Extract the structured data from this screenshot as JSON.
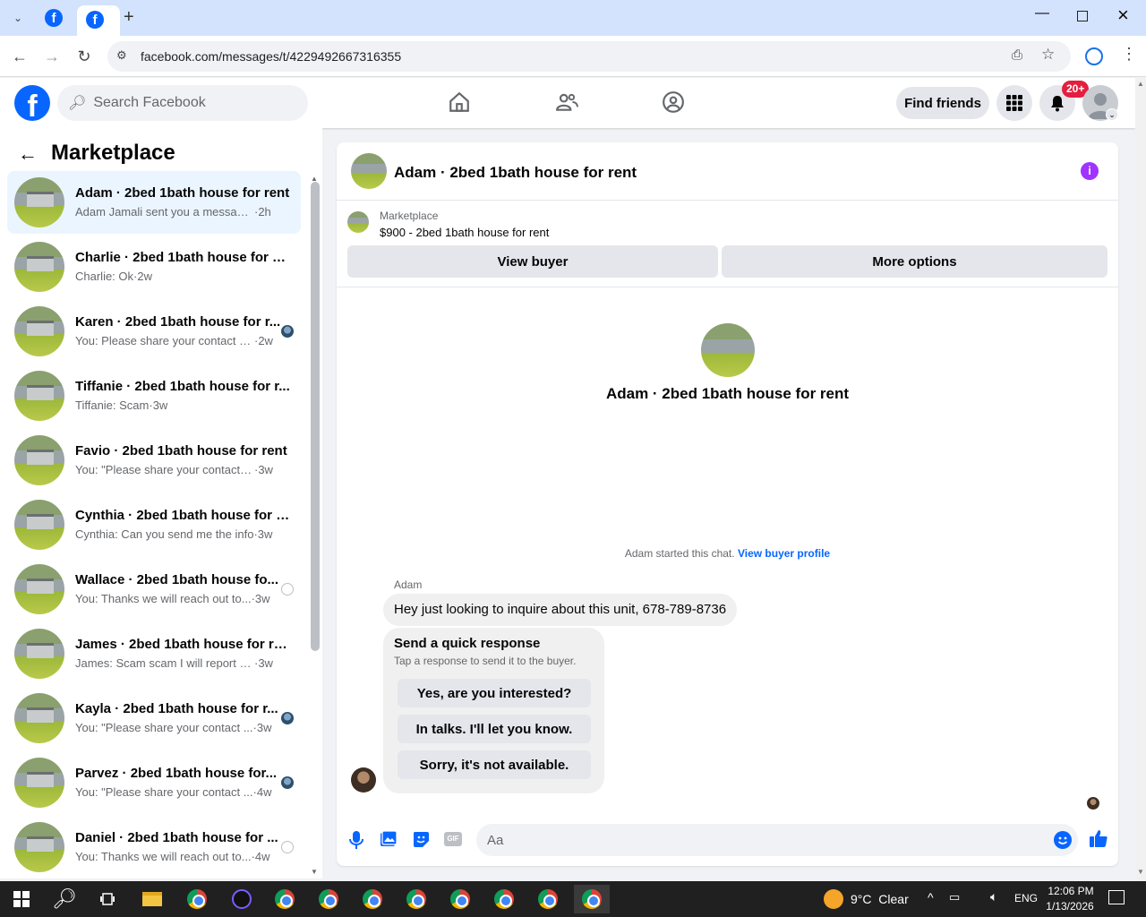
{
  "browser": {
    "url": "facebook.com/messages/t/4229492667316355",
    "new_tab": "+"
  },
  "header": {
    "search_placeholder": "Search Facebook",
    "find_friends": "Find friends",
    "notif_badge": "20+"
  },
  "sidebar": {
    "title": "Marketplace",
    "items": [
      {
        "name": "Adam · 2bed 1bath house for rent",
        "snippet": "Adam Jamali sent you a message a...",
        "time": "·2h",
        "selected": true
      },
      {
        "name": "Charlie · 2bed 1bath house for re...",
        "snippet": "Charlie: Ok",
        "time": "·2w"
      },
      {
        "name": "Karen · 2bed 1bath house for r...",
        "snippet": "You: Please share your contact n...",
        "time": "·2w",
        "mark": "avatar"
      },
      {
        "name": "Tiffanie · 2bed 1bath house for r...",
        "snippet": "Tiffanie: Scam",
        "time": "·3w"
      },
      {
        "name": "Favio · 2bed 1bath house for rent",
        "snippet": "You: \"Please share your contact nu...",
        "time": "·3w"
      },
      {
        "name": "Cynthia · 2bed 1bath house for r...",
        "snippet": "Cynthia: Can you send me the info",
        "time": "·3w"
      },
      {
        "name": "Wallace · 2bed 1bath house fo...",
        "snippet": "You: Thanks we will reach out to...",
        "time": "·3w",
        "mark": "circle"
      },
      {
        "name": "James · 2bed 1bath house for rent",
        "snippet": "James: Scam scam I will report to c...",
        "time": "·3w"
      },
      {
        "name": "Kayla · 2bed 1bath house for r...",
        "snippet": "You: \"Please share your contact ...",
        "time": "·3w",
        "mark": "avatar"
      },
      {
        "name": "Parvez · 2bed 1bath house for...",
        "snippet": "You: \"Please share your contact ...",
        "time": "·4w",
        "mark": "avatar"
      },
      {
        "name": "Daniel · 2bed 1bath house for ...",
        "snippet": "You: Thanks we will reach out to...",
        "time": "·4w",
        "mark": "circle"
      }
    ]
  },
  "chat": {
    "title": "Adam · 2bed 1bath house for rent",
    "listing_label": "Marketplace",
    "listing_desc": "$900 - 2bed 1bath house for rent",
    "view_buyer": "View buyer",
    "more_options": "More options",
    "center_title": "Adam · 2bed 1bath house for rent",
    "started": "Adam started this chat.",
    "view_buyer_profile": "View buyer profile",
    "sender": "Adam",
    "message": "Hey just looking to inquire about this unit, 678-789-8736",
    "quick_title": "Send a quick response",
    "quick_sub": "Tap a response to send it to the buyer.",
    "quick_responses": [
      "Yes, are you interested?",
      "In talks. I'll let you know.",
      "Sorry, it's not available."
    ],
    "composer_placeholder": "Aa"
  },
  "taskbar": {
    "weather": "9°C  Clear",
    "lang": "ENG",
    "time": "12:06 PM",
    "date": "1/13/2026"
  },
  "colors": {
    "fb_blue": "#0866ff",
    "badge_red": "#e41e3f",
    "info_purple": "#a033ff"
  }
}
